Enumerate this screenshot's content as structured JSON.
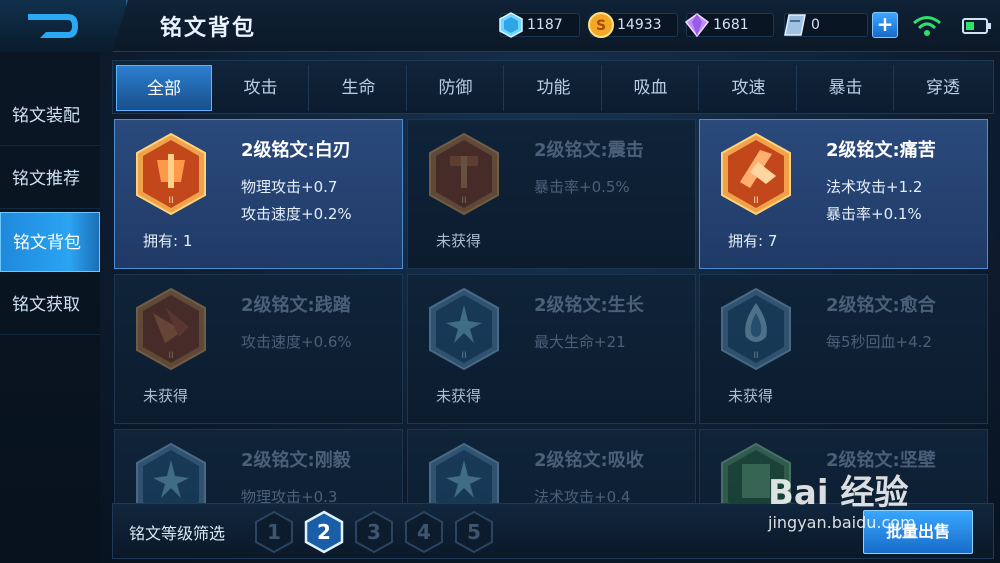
{
  "header": {
    "title": "铭文背包",
    "currencies": [
      {
        "icon": "diamond-crystal-icon",
        "value": "1187"
      },
      {
        "icon": "gold-coin-icon",
        "value": "14933"
      },
      {
        "icon": "purple-gem-icon",
        "value": "1681"
      },
      {
        "icon": "coupon-icon",
        "value": "0"
      }
    ],
    "plus_label": "+"
  },
  "sidebar": {
    "items": [
      {
        "label": "铭文装配",
        "active": false
      },
      {
        "label": "铭文推荐",
        "active": false
      },
      {
        "label": "铭文背包",
        "active": true
      },
      {
        "label": "铭文获取",
        "active": false
      }
    ]
  },
  "tabs": [
    {
      "label": "全部",
      "active": true
    },
    {
      "label": "攻击",
      "active": false
    },
    {
      "label": "生命",
      "active": false
    },
    {
      "label": "防御",
      "active": false
    },
    {
      "label": "功能",
      "active": false
    },
    {
      "label": "吸血",
      "active": false
    },
    {
      "label": "攻速",
      "active": false
    },
    {
      "label": "暴击",
      "active": false
    },
    {
      "label": "穿透",
      "active": false
    }
  ],
  "cards": [
    {
      "name": "2级铭文:白刃",
      "stats": [
        "物理攻击+0.7",
        "攻击速度+0.2%"
      ],
      "owned": "拥有: 1",
      "state": "owned",
      "color": "red"
    },
    {
      "name": "2级铭文:震击",
      "stats": [
        "暴击率+0.5%",
        ""
      ],
      "owned": "未获得",
      "state": "locked",
      "color": "red"
    },
    {
      "name": "2级铭文:痛苦",
      "stats": [
        "法术攻击+1.2",
        "暴击率+0.1%"
      ],
      "owned": "拥有: 7",
      "state": "owned",
      "color": "red"
    },
    {
      "name": "2级铭文:践踏",
      "stats": [
        "攻击速度+0.6%",
        ""
      ],
      "owned": "未获得",
      "state": "locked",
      "color": "red"
    },
    {
      "name": "2级铭文:生长",
      "stats": [
        "最大生命+21",
        ""
      ],
      "owned": "未获得",
      "state": "locked",
      "color": "blue"
    },
    {
      "name": "2级铭文:愈合",
      "stats": [
        "每5秒回血+4.2",
        ""
      ],
      "owned": "未获得",
      "state": "locked",
      "color": "blue"
    },
    {
      "name": "2级铭文:刚毅",
      "stats": [
        "物理攻击+0.3",
        ""
      ],
      "owned": "",
      "state": "locked",
      "color": "blue"
    },
    {
      "name": "2级铭文:吸收",
      "stats": [
        "法术攻击+0.4",
        ""
      ],
      "owned": "",
      "state": "locked",
      "color": "blue"
    },
    {
      "name": "2级铭文:坚壁",
      "stats": [
        "",
        ""
      ],
      "owned": "",
      "state": "locked",
      "color": "green"
    }
  ],
  "emblem_level_mark": "II",
  "bottom": {
    "filter_label": "铭文等级筛选",
    "levels": [
      "1",
      "2",
      "3",
      "4",
      "5"
    ],
    "active_level": "2",
    "batch_sell_label": "批量出售"
  },
  "watermark": {
    "logo": "Bai 经验",
    "url": "jingyan.baidu.com"
  },
  "colors": {
    "accent": "#2ba4f2",
    "emblem_red": "#d9631f",
    "emblem_blue": "#3f8fc0",
    "emblem_green": "#3d8f4a",
    "gold": "#e8b64a"
  }
}
